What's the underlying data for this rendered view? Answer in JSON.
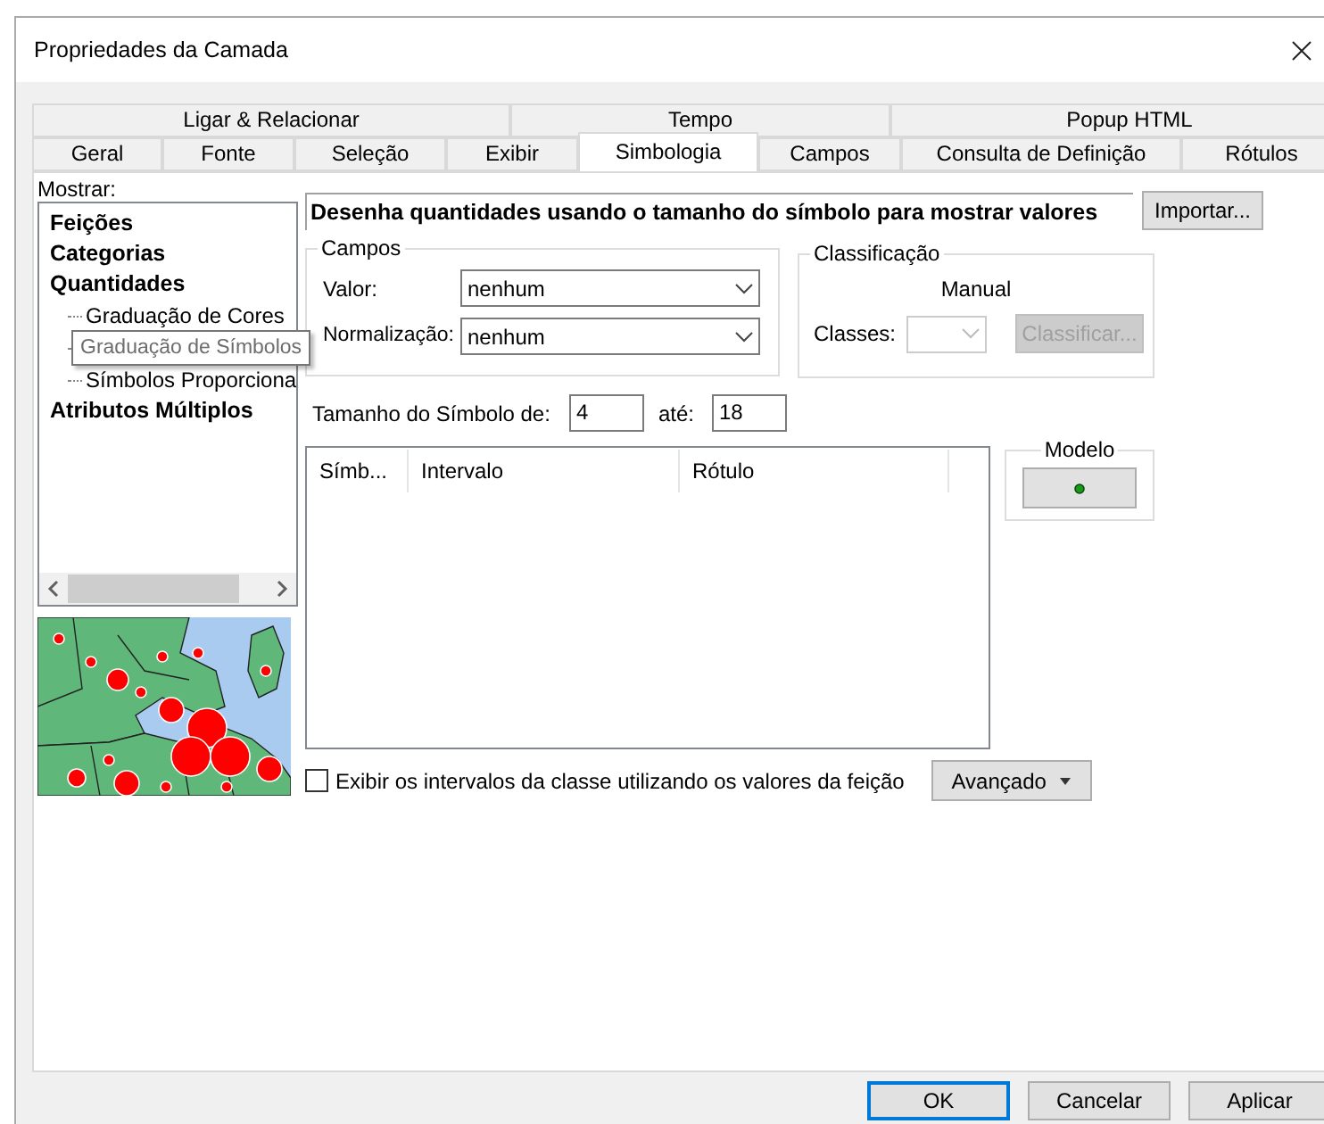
{
  "window": {
    "title": "Propriedades da Camada"
  },
  "tab_rows": [
    {
      "tabs": [
        {
          "label": "Ligar & Relacionar",
          "selected": false
        },
        {
          "label": "Tempo",
          "selected": false
        },
        {
          "label": "Popup HTML",
          "selected": false
        }
      ]
    },
    {
      "tabs": [
        {
          "label": "Geral",
          "selected": false
        },
        {
          "label": "Fonte",
          "selected": false
        },
        {
          "label": "Seleção",
          "selected": false
        },
        {
          "label": "Exibir",
          "selected": false
        },
        {
          "label": "Simbologia",
          "selected": true
        },
        {
          "label": "Campos",
          "selected": false
        },
        {
          "label": "Consulta de Definição",
          "selected": false
        },
        {
          "label": "Rótulos",
          "selected": false
        }
      ]
    }
  ],
  "show": {
    "label": "Mostrar:",
    "tree": [
      {
        "label": "Feições"
      },
      {
        "label": "Categorias"
      },
      {
        "label": "Quantidades",
        "children": [
          {
            "label": "Graduação de Cores",
            "hovered": false
          },
          {
            "label": "Graduação de Símbolos",
            "hovered": true
          },
          {
            "label": "Símbolos Proporciona",
            "hovered": false
          }
        ]
      },
      {
        "label": "Atributos Múltiplos"
      }
    ]
  },
  "description": "Desenha quantidades usando o tamanho do símbolo para mostrar valores",
  "import_button": "Importar...",
  "fields": {
    "title": "Campos",
    "value_label": "Valor:",
    "value": "nenhum",
    "normalization_label": "Normalização:",
    "normalization": "nenhum"
  },
  "classification": {
    "title": "Classificação",
    "method": "Manual",
    "classes_label": "Classes:",
    "classes_disabled": true,
    "classify_button": "Classificar...",
    "classify_disabled": true
  },
  "symbol_size": {
    "label": "Tamanho do Símbolo de:",
    "from": "4",
    "to_label": "até:",
    "to": "18"
  },
  "table": {
    "columns": [
      "Símb...",
      "Intervalo",
      "Rótulo"
    ]
  },
  "template": {
    "title": "Modelo"
  },
  "class_ranges": {
    "label": "Exibir os intervalos da classe utilizando os valores da feição",
    "checked": false
  },
  "advanced_button": "Avançado",
  "buttons": [
    {
      "label": "OK",
      "focused": true
    },
    {
      "label": "Cancelar",
      "focused": false
    },
    {
      "label": "Aplicar",
      "focused": false
    }
  ]
}
